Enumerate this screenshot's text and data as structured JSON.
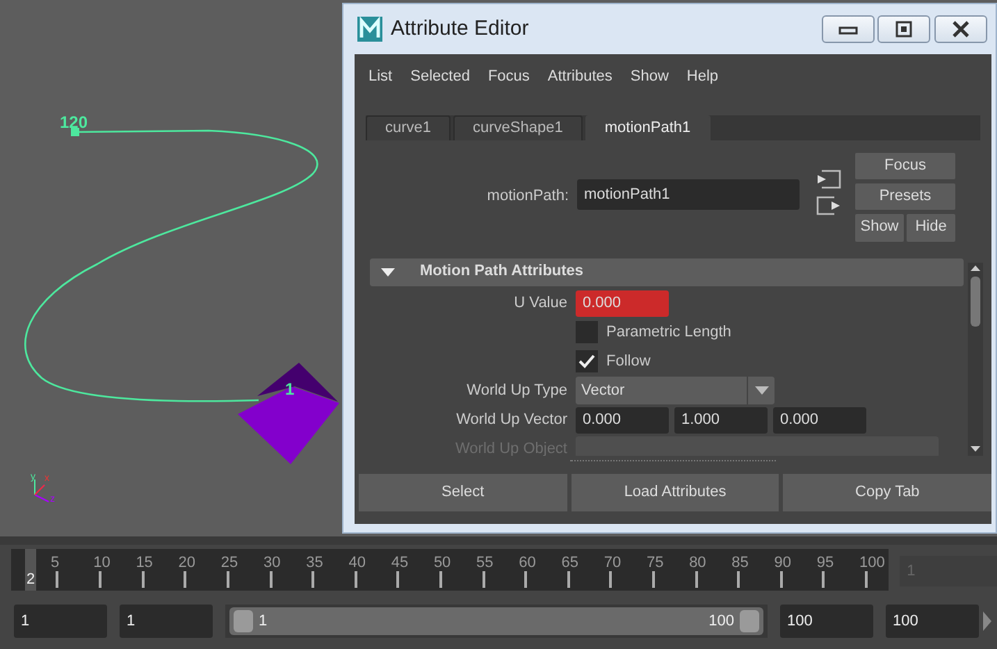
{
  "viewport": {
    "curve_labels": [
      "120",
      "1"
    ],
    "axis_labels": [
      "y",
      "x",
      "z"
    ]
  },
  "window": {
    "title": "Attribute Editor"
  },
  "menu": [
    "List",
    "Selected",
    "Focus",
    "Attributes",
    "Show",
    "Help"
  ],
  "tabs": [
    {
      "label": "curve1",
      "selected": false
    },
    {
      "label": "curveShape1",
      "selected": false
    },
    {
      "label": "motionPath1",
      "selected": true
    }
  ],
  "node_field": {
    "label": "motionPath:",
    "value": "motionPath1"
  },
  "side_buttons": [
    "Focus",
    "Presets",
    "Show",
    "Hide"
  ],
  "section": {
    "title": "Motion Path Attributes",
    "expanded": true,
    "rows": [
      {
        "kind": "field",
        "label": "U Value",
        "value": "0.000",
        "keyed": true
      },
      {
        "kind": "checkbox",
        "label": "Parametric Length",
        "checked": false
      },
      {
        "kind": "checkbox",
        "label": "Follow",
        "checked": true
      },
      {
        "kind": "dropdown",
        "label": "World Up Type",
        "value": "Vector"
      },
      {
        "kind": "vector",
        "label": "World Up Vector",
        "values": [
          "0.000",
          "1.000",
          "0.000"
        ]
      },
      {
        "kind": "field",
        "label": "World Up Object",
        "disabled": true
      }
    ]
  },
  "buttons": [
    "Select",
    "Load Attributes",
    "Copy Tab"
  ],
  "timeline": {
    "ticks": [
      "5",
      "10",
      "15",
      "20",
      "25",
      "30",
      "35",
      "40",
      "45",
      "50",
      "55",
      "60",
      "65",
      "70",
      "75",
      "80",
      "85",
      "90",
      "95",
      "100"
    ],
    "current_frame": "2",
    "frame_field": "1"
  },
  "range": {
    "level": 1,
    "start": "1",
    "playback_start": "1",
    "slider_start": "1",
    "slider_end": "100",
    "playback_end": "100",
    "end": "100"
  }
}
